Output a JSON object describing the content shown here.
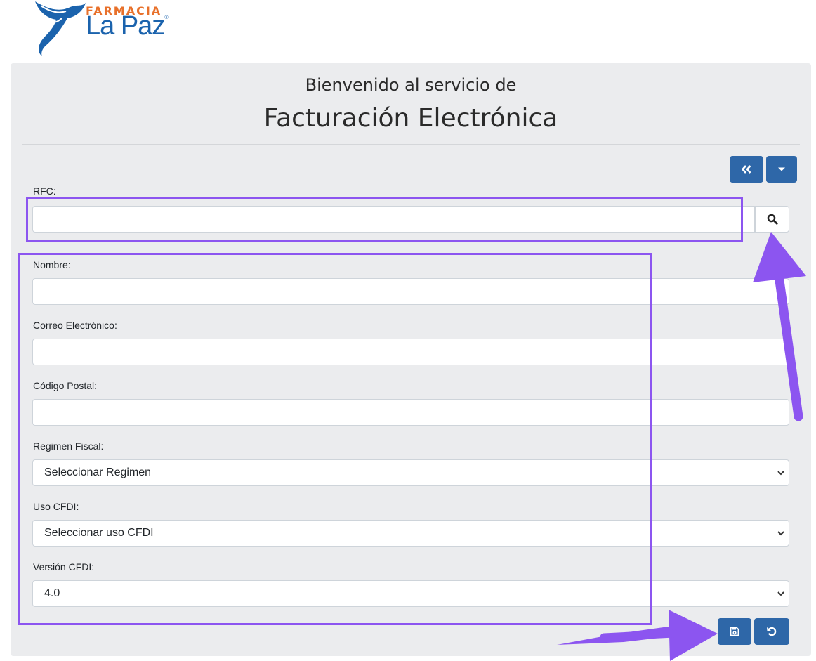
{
  "brand": {
    "top": "FARMACIA",
    "main": "La Paz",
    "mark": "®"
  },
  "header": {
    "subtitle": "Bienvenido al servicio de",
    "title": "Facturación Electrónica"
  },
  "toolbar": {
    "back_icon": "double-chevron-left-icon",
    "menu_icon": "caret-down-icon"
  },
  "form": {
    "rfc": {
      "label": "RFC:",
      "value": ""
    },
    "search_icon": "search-icon",
    "nombre": {
      "label": "Nombre:",
      "value": ""
    },
    "correo": {
      "label": "Correo Electrónico:",
      "value": ""
    },
    "codigo_postal": {
      "label": "Código Postal:",
      "value": ""
    },
    "regimen": {
      "label": "Regimen Fiscal:",
      "selected": "Seleccionar Regimen"
    },
    "uso_cfdi": {
      "label": "Uso CFDI:",
      "selected": "Seleccionar uso CFDI"
    },
    "version_cfdi": {
      "label": "Versión CFDI:",
      "selected": "4.0"
    }
  },
  "actions": {
    "save_icon": "floppy-disk-icon",
    "reset_icon": "undo-icon"
  },
  "colors": {
    "primary": "#2e67a8",
    "annotation": "#8c55f0",
    "brand_orange": "#e8702a",
    "brand_blue": "#1b63ad"
  }
}
